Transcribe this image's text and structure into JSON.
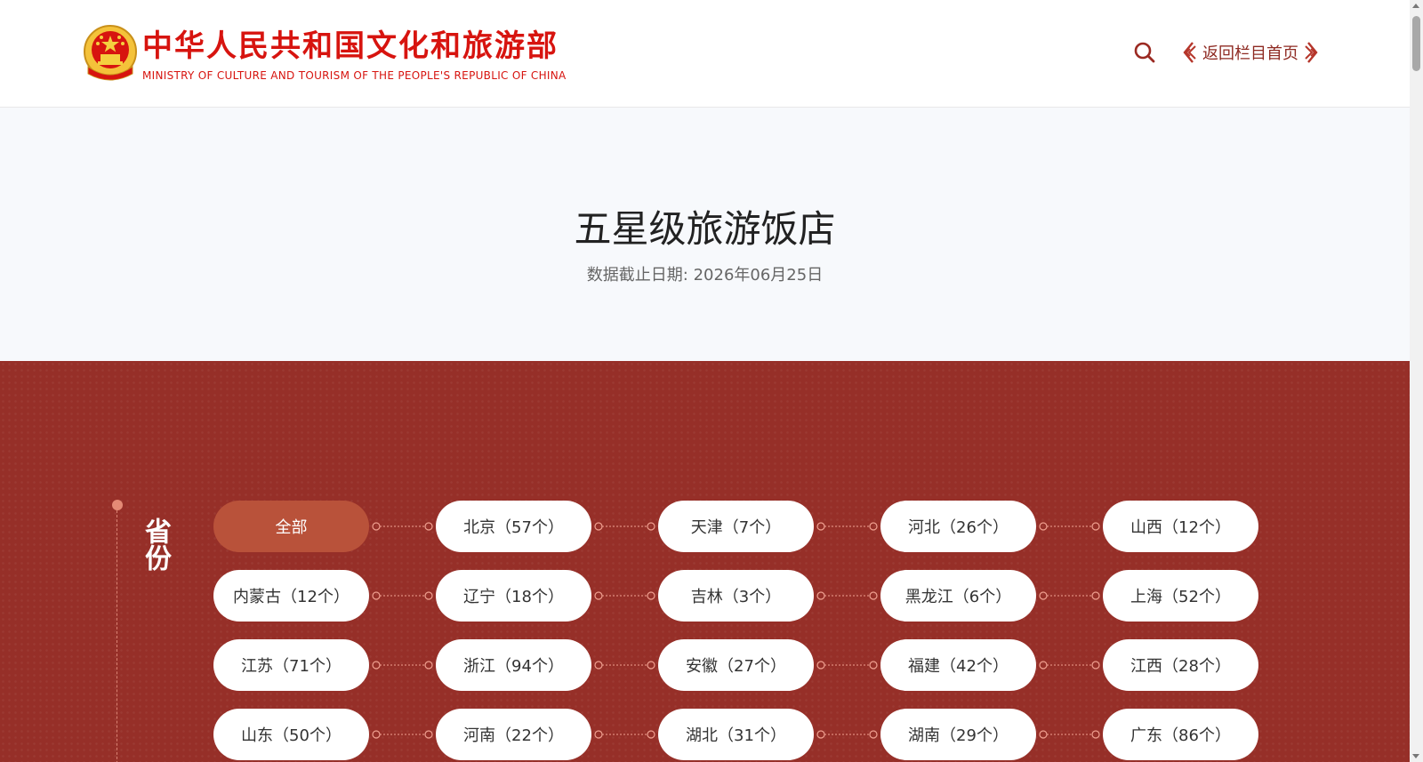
{
  "header": {
    "logo_cn": "中华人民共和国文化和旅游部",
    "logo_en": "MINISTRY OF CULTURE AND TOURISM OF THE PEOPLE'S REPUBLIC OF CHINA",
    "back_label": "返回栏目首页"
  },
  "hero": {
    "title": "五星级旅游饭店",
    "date_line": "数据截止日期: 2026年06月25日"
  },
  "filter": {
    "label": "省份",
    "items": [
      {
        "label": "全部",
        "active": true
      },
      {
        "label": "北京（57个）"
      },
      {
        "label": "天津（7个）"
      },
      {
        "label": "河北（26个）"
      },
      {
        "label": "山西（12个）"
      },
      {
        "label": "内蒙古（12个）"
      },
      {
        "label": "辽宁（18个）"
      },
      {
        "label": "吉林（3个）"
      },
      {
        "label": "黑龙江（6个）"
      },
      {
        "label": "上海（52个）"
      },
      {
        "label": "江苏（71个）"
      },
      {
        "label": "浙江（94个）"
      },
      {
        "label": "安徽（27个）"
      },
      {
        "label": "福建（42个）"
      },
      {
        "label": "江西（28个）"
      },
      {
        "label": "山东（50个）"
      },
      {
        "label": "河南（22个）"
      },
      {
        "label": "湖北（31个）"
      },
      {
        "label": "湖南（29个）"
      },
      {
        "label": "广东（86个）"
      }
    ]
  },
  "colors": {
    "brand_red": "#d7140f",
    "section_red": "#962f28",
    "active_pill": "#b9523a",
    "link": "#8e2a22"
  },
  "icons": {
    "emblem": "national-emblem-icon",
    "search": "search-icon",
    "back_ornaments": "ornament-icon"
  }
}
